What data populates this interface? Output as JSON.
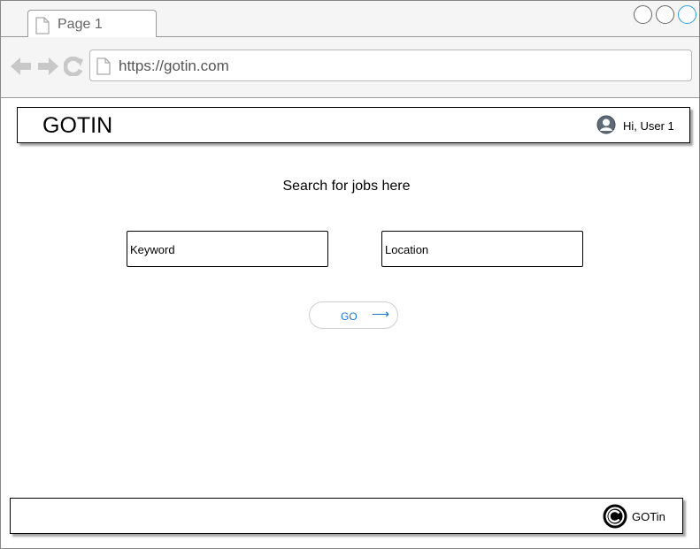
{
  "browser": {
    "tab_label": "Page 1",
    "url": "https://gotin.com"
  },
  "header": {
    "logo": "GOTIN",
    "user_greeting": "Hi, User 1"
  },
  "main": {
    "search_title": "Search for jobs here",
    "keyword_placeholder": "Keyword",
    "location_placeholder": "Location",
    "go_label": "GO",
    "go_arrow": "⟶"
  },
  "footer": {
    "text": "GOTin"
  },
  "colors": {
    "link_blue": "#1e74c8",
    "active_window_button": "#2b9fd8"
  },
  "icons": [
    "page-icon",
    "back-arrow-icon",
    "forward-arrow-icon",
    "reload-icon",
    "user-icon",
    "copyright-icon"
  ]
}
